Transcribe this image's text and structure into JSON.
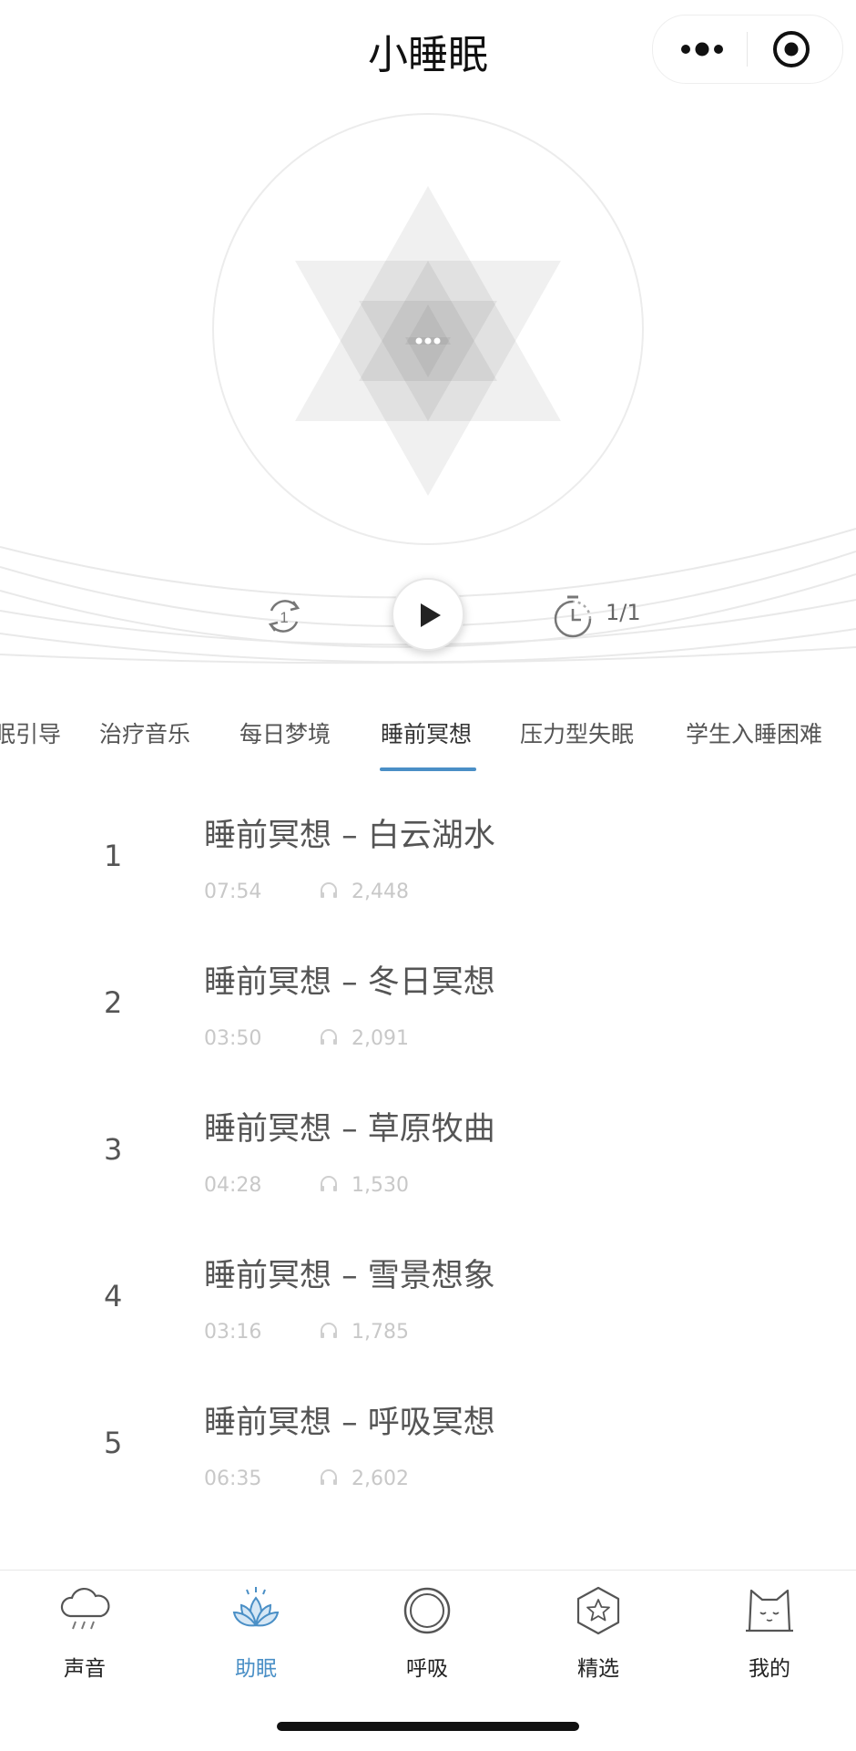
{
  "header": {
    "title": "小睡眠"
  },
  "player": {
    "timer_count": "1/1"
  },
  "tabs": [
    {
      "label": "眠引导"
    },
    {
      "label": "治疗音乐"
    },
    {
      "label": "每日梦境"
    },
    {
      "label": "睡前冥想",
      "active": true
    },
    {
      "label": "压力型失眠"
    },
    {
      "label": "学生入睡困难"
    }
  ],
  "tracks": [
    {
      "index": "1",
      "title": "睡前冥想 – 白云湖水",
      "duration": "07:54",
      "plays": "2,448"
    },
    {
      "index": "2",
      "title": "睡前冥想 – 冬日冥想",
      "duration": "03:50",
      "plays": "2,091"
    },
    {
      "index": "3",
      "title": "睡前冥想 – 草原牧曲",
      "duration": "04:28",
      "plays": "1,530"
    },
    {
      "index": "4",
      "title": "睡前冥想 – 雪景想象",
      "duration": "03:16",
      "plays": "1,785"
    },
    {
      "index": "5",
      "title": "睡前冥想 – 呼吸冥想",
      "duration": "06:35",
      "plays": "2,602"
    }
  ],
  "nav": [
    {
      "label": "声音",
      "icon": "cloud-rain-icon"
    },
    {
      "label": "助眠",
      "icon": "lotus-icon",
      "active": true
    },
    {
      "label": "呼吸",
      "icon": "ring-icon"
    },
    {
      "label": "精选",
      "icon": "star-hexagon-icon"
    },
    {
      "label": "我的",
      "icon": "cat-icon"
    }
  ],
  "colors": {
    "accent": "#4a8fc6",
    "text": "#555555",
    "muted": "#c8c8c8"
  }
}
